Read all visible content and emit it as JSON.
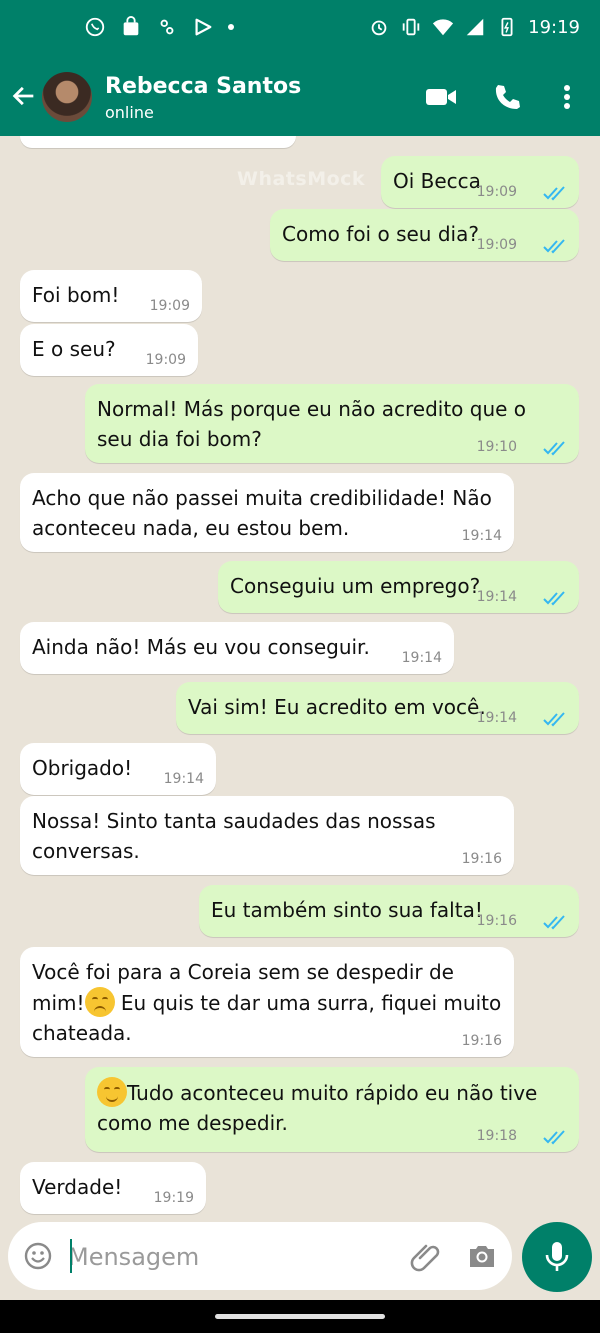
{
  "status_bar": {
    "time": "19:19"
  },
  "header": {
    "contact_name": "Rebecca Santos",
    "status": "online",
    "watermark": "WhatsMock"
  },
  "messages": [
    {
      "dir": "out",
      "text": "Oi Becca",
      "time": "19:09",
      "read": true
    },
    {
      "dir": "out",
      "text": "Como foi o seu dia?",
      "time": "19:09",
      "read": true
    },
    {
      "dir": "in",
      "text": "Foi bom!",
      "time": "19:09"
    },
    {
      "dir": "in",
      "text": "E o seu?",
      "time": "19:09"
    },
    {
      "dir": "out",
      "text_lines": [
        "Normal! Más porque eu não acredito que o",
        "seu dia foi bom?"
      ],
      "time": "19:10",
      "read": true
    },
    {
      "dir": "in",
      "text_lines": [
        "Acho que não passei muita credibilidade! Não",
        "aconteceu nada, eu estou bem."
      ],
      "time": "19:14"
    },
    {
      "dir": "out",
      "text": "Conseguiu um emprego?",
      "time": "19:14",
      "read": true
    },
    {
      "dir": "in",
      "text": "Ainda não! Más eu vou conseguir.",
      "time": "19:14"
    },
    {
      "dir": "out",
      "text": "Vai sim! Eu acredito em você.",
      "time": "19:14",
      "read": true
    },
    {
      "dir": "in",
      "text": "Obrigado!",
      "time": "19:14"
    },
    {
      "dir": "in",
      "text_lines": [
        "Nossa! Sinto tanta saudades das nossas",
        "conversas."
      ],
      "time": "19:16"
    },
    {
      "dir": "out",
      "text": "Eu também sinto sua falta!",
      "time": "19:16",
      "read": true
    },
    {
      "dir": "in",
      "line1": "Você foi para a Coreia sem se despedir de",
      "line2_start": "mim!",
      "line2_end": " Eu quis te dar uma surra, fiquei muito",
      "line3": "chateada.",
      "emoji": "pensive-face-emoji",
      "time": "19:16"
    },
    {
      "dir": "out",
      "line1": "Tudo aconteceu muito rápido eu não tive",
      "line2": "como me despedir.",
      "emoji": "smiling-face-emoji",
      "time": "19:18",
      "read": true
    },
    {
      "dir": "in",
      "text": "Verdade!",
      "time": "19:19"
    }
  ],
  "composer": {
    "placeholder": "Mensagem"
  },
  "colors": {
    "header": "#008069",
    "outgoing": "#dcf8c6",
    "incoming": "#ffffff",
    "read_ticks": "#34b7f1"
  }
}
